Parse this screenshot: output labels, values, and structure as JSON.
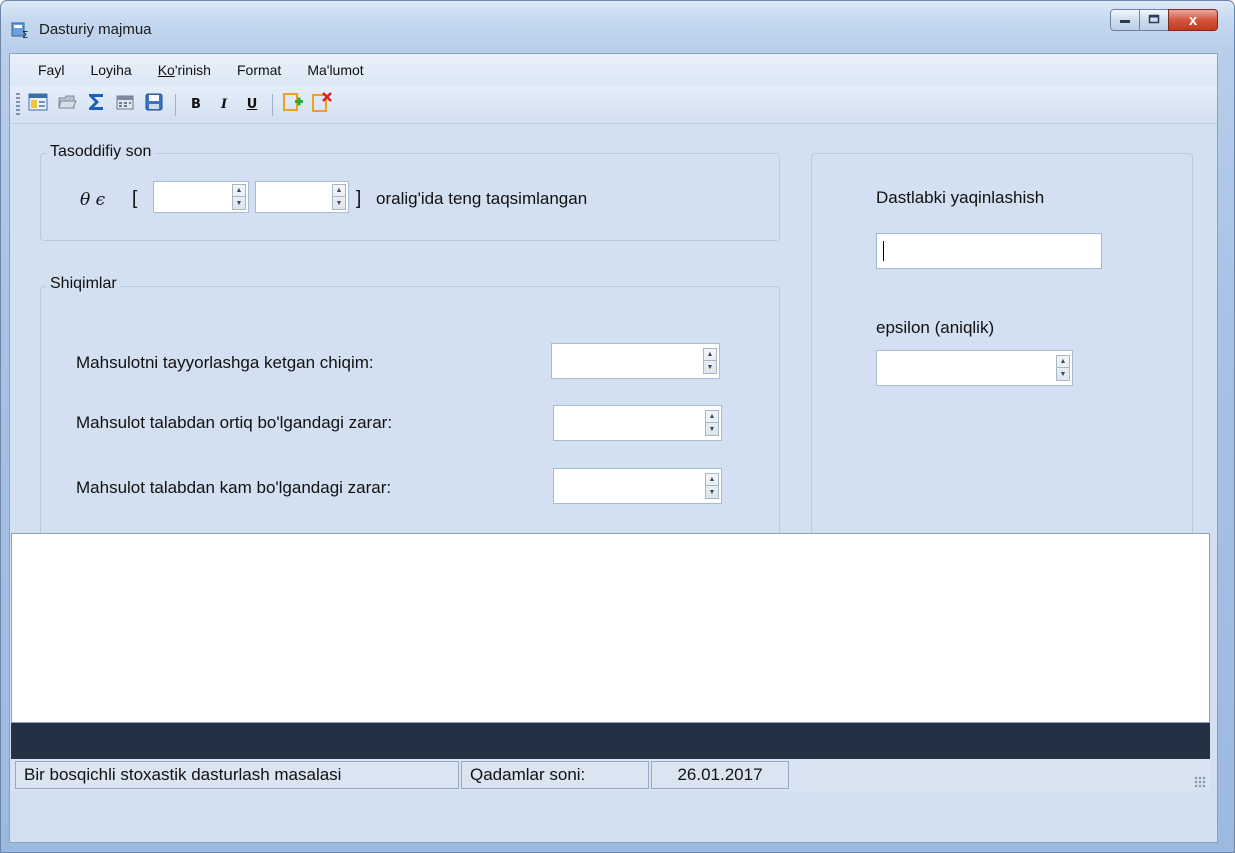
{
  "window": {
    "title": "Dasturiy majmua",
    "buttons": {
      "minimize_icon": "minimize-icon",
      "maximize_icon": "maximize-icon",
      "close_glyph": "x"
    }
  },
  "menu": [
    {
      "label": "Fayl"
    },
    {
      "label": "Loyiha"
    },
    {
      "label": "Ko'rinish",
      "underline_prefix": "Ko",
      "rest": "'rinish"
    },
    {
      "label": "Format"
    },
    {
      "label": "Ma'lumot"
    }
  ],
  "toolbar": {
    "icons": [
      "form-icon",
      "open-folder-icon",
      "sigma-icon",
      "calendar-icon",
      "save-icon"
    ],
    "bold": "B",
    "italic": "I",
    "underline": "U",
    "add_icon": "add-document-icon",
    "delete_icon": "delete-document-icon"
  },
  "random_group": {
    "title": "Tasoddifiy son",
    "theta_symbol": "θ ϵ",
    "open_bracket": "[",
    "close_bracket": "]",
    "range_text": "oralig'ida teng taqsimlangan",
    "min_value": "",
    "max_value": ""
  },
  "costs_group": {
    "title": "Shiqimlar",
    "rows": [
      {
        "label": "Mahsulotni tayyorlashga ketgan chiqim:",
        "value": ""
      },
      {
        "label": "Mahsulot talabdan ortiq bo'lgandagi zarar:",
        "value": ""
      },
      {
        "label": "Mahsulot talabdan kam bo'lgandagi zarar:",
        "value": ""
      }
    ]
  },
  "right_panel": {
    "initial_label": "Dastlabki yaqinlashish",
    "initial_value": "",
    "epsilon_label": "epsilon (aniqlik)",
    "epsilon_value": ""
  },
  "status": {
    "problem": "Bir bosqichli stoxastik dasturlash masalasi",
    "steps_label": "Qadamlar soni:",
    "date": "26.01.2017"
  },
  "colors": {
    "client_bg": "#d3e0f1",
    "darkbar": "#243145",
    "close_button": "#c2391f"
  }
}
